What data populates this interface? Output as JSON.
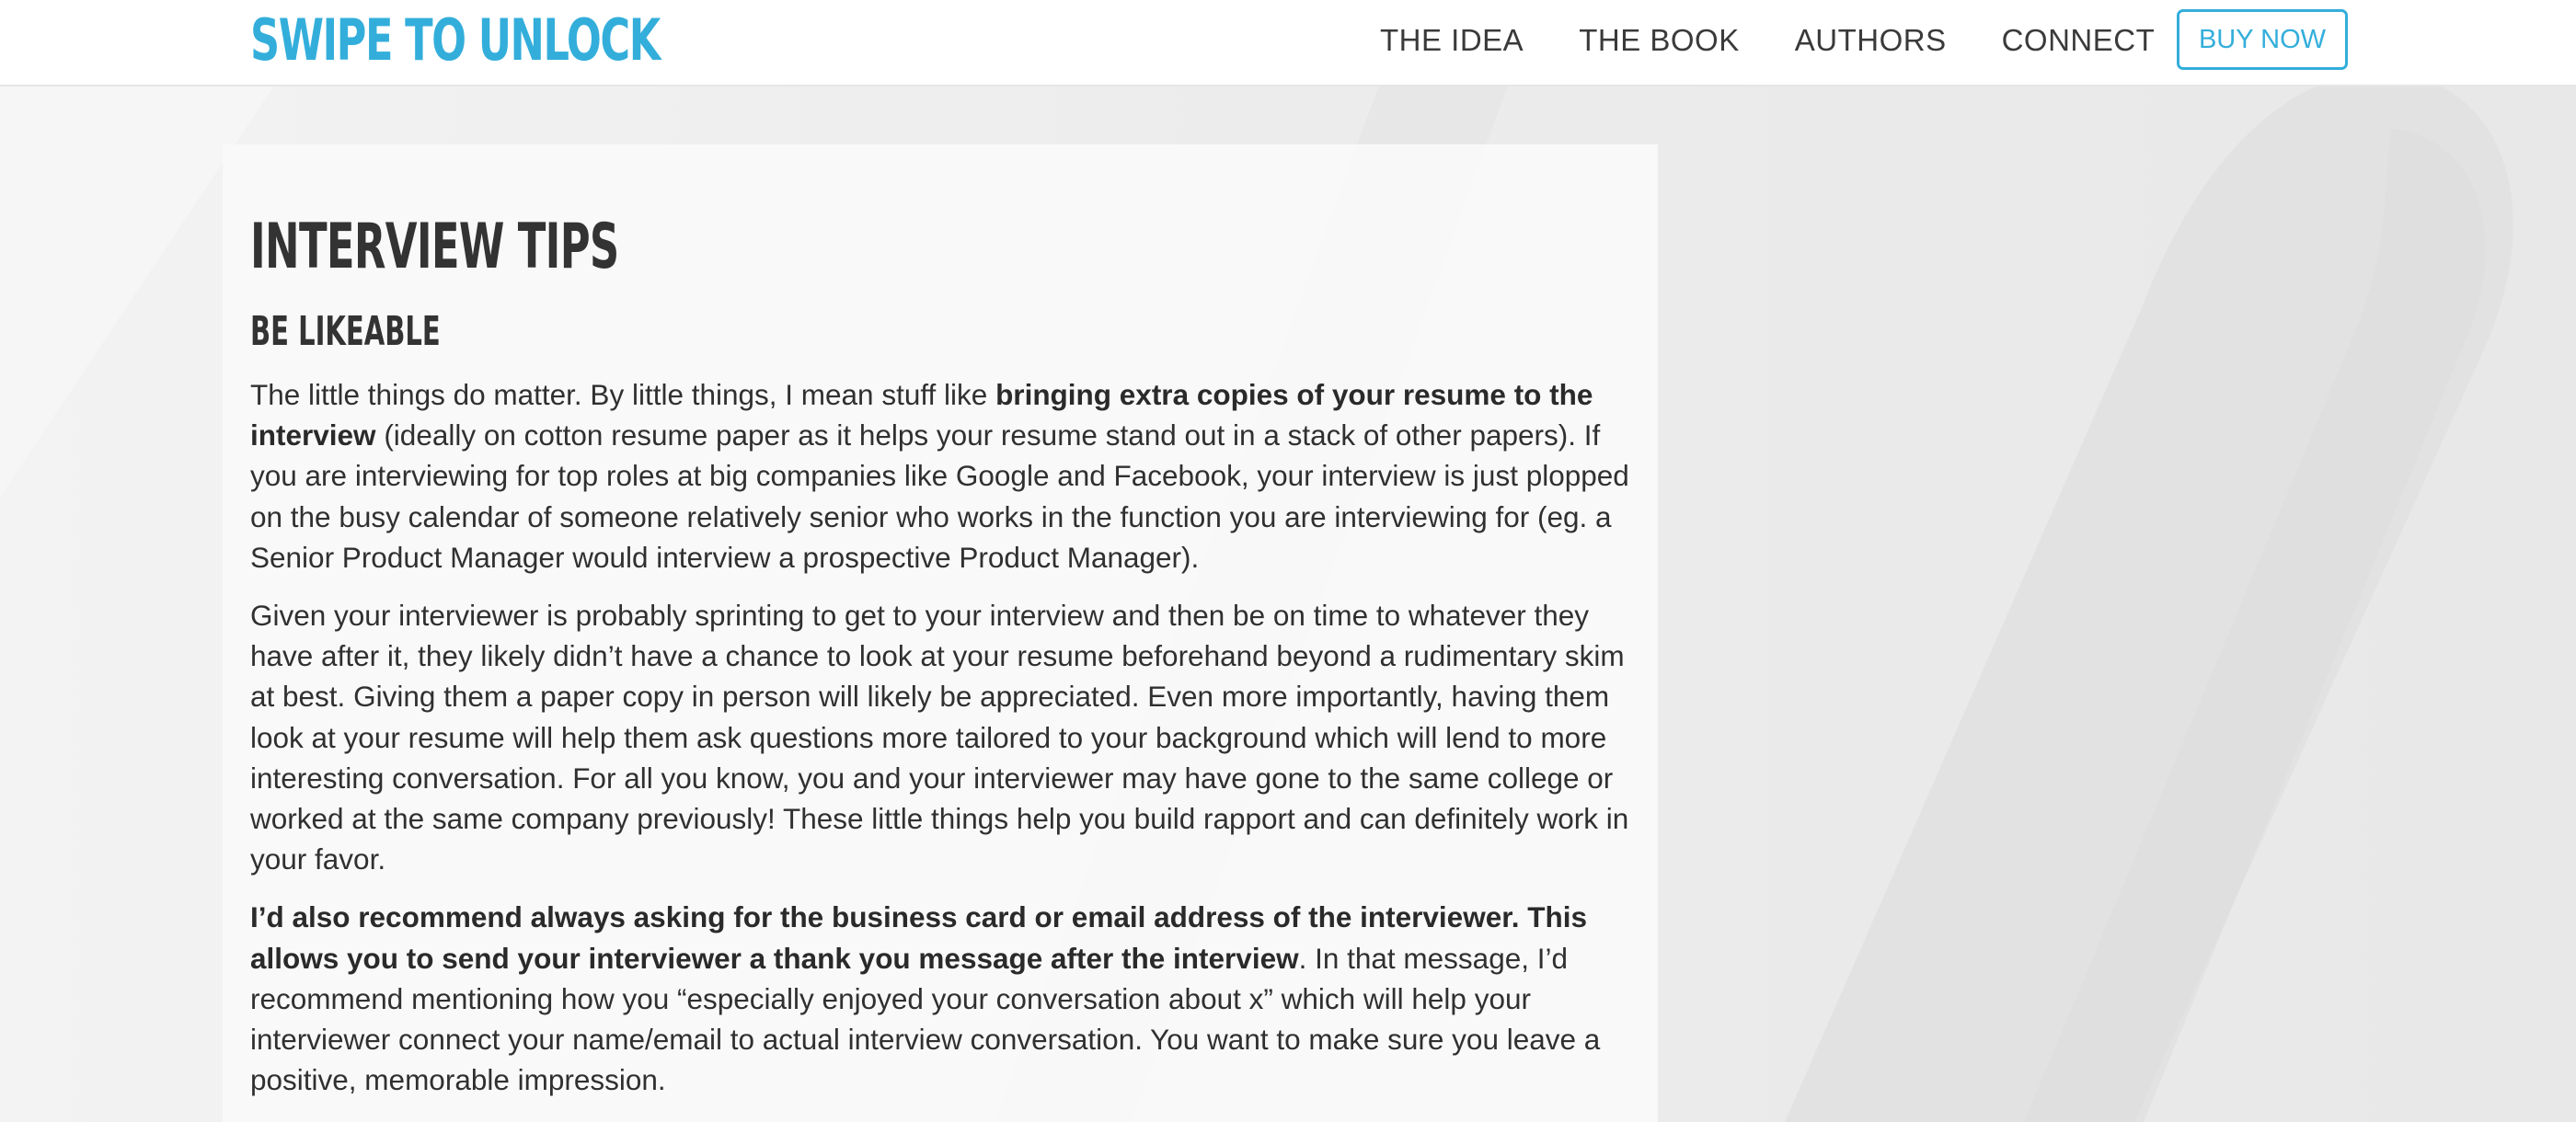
{
  "site": {
    "logo_text": "SWIPE TO UNLOCK",
    "accent_color": "#33aedb"
  },
  "nav": {
    "links": [
      {
        "label": "THE IDEA"
      },
      {
        "label": "THE BOOK"
      },
      {
        "label": "AUTHORS"
      },
      {
        "label": "CONNECT"
      }
    ],
    "cta_label": "BUY NOW"
  },
  "article": {
    "title": "INTERVIEW TIPS",
    "section_heading": "BE LIKEABLE",
    "paragraphs": [
      {
        "segments": [
          {
            "text": "The little things do matter. By little things, I mean stuff like ",
            "bold": false
          },
          {
            "text": "bringing extra copies of your resume to the interview",
            "bold": true
          },
          {
            "text": " (ideally on cotton resume paper as it helps your resume stand out in a stack of other papers). If you are interviewing for top roles at big companies like Google and Facebook, your interview is just plopped on the busy calendar of someone relatively senior who works in the function you are interviewing for (eg. a Senior Product Manager would interview a prospective Product Manager).",
            "bold": false
          }
        ]
      },
      {
        "segments": [
          {
            "text": "Given your interviewer is probably sprinting to get to your interview and then be on time to whatever they have after it, they likely didn’t have a chance to look at your resume beforehand beyond a rudimentary skim at best. Giving them a paper copy in person will likely be appreciated. Even more importantly, having them look at your resume will help them ask questions more tailored to your background which will lend to more interesting conversation. For all you know, you and your interviewer may have gone to the same college or worked at the same company previously! These little things help you build rapport and can definitely work in your favor.",
            "bold": false
          }
        ]
      },
      {
        "segments": [
          {
            "text": "I’d also recommend always asking for the business card or email address of the interviewer. This allows you to send your interviewer a thank you message after the interview",
            "bold": true
          },
          {
            "text": ". In that message, I’d recommend mentioning how you “especially enjoyed your conversation about x” which will help your interviewer connect your name/email to actual interview conversation. You want to make sure you leave a positive, memorable impression.",
            "bold": false
          }
        ]
      }
    ]
  }
}
